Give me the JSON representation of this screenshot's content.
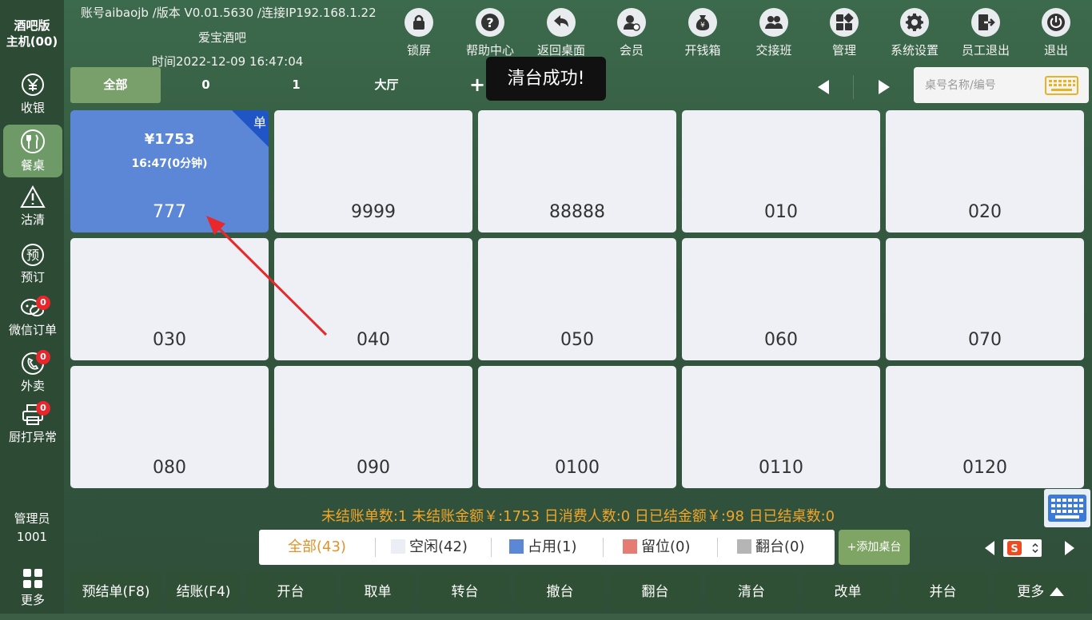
{
  "sidebar": {
    "title_line1": "酒吧版",
    "title_line2": "主机(00)",
    "items": [
      {
        "label": "收银",
        "icon": "yen-circle-icon",
        "badge": ""
      },
      {
        "label": "餐桌",
        "icon": "fork-knife-icon",
        "badge": ""
      },
      {
        "label": "沽清",
        "icon": "warning-icon",
        "badge": ""
      },
      {
        "label": "预订",
        "icon": "reserve-icon",
        "badge": ""
      },
      {
        "label": "微信订单",
        "icon": "wechat-icon",
        "badge": "0"
      },
      {
        "label": "外卖",
        "icon": "phone-icon",
        "badge": "0"
      },
      {
        "label": "厨打异常",
        "icon": "printer-icon",
        "badge": "0"
      }
    ],
    "user_role": "管理员",
    "user_id": "1001",
    "more_label": "更多"
  },
  "header": {
    "account_info": "账号aibaojb /版本 V0.01.5630 /连接IP192.168.1.22",
    "shop_name": "爱宝酒吧",
    "time_text": "时间2022-12-09 16:47:04",
    "toolbar": [
      {
        "label": "锁屏",
        "icon": "lock-icon"
      },
      {
        "label": "帮助中心",
        "icon": "help-icon"
      },
      {
        "label": "返回桌面",
        "icon": "back-arrow-icon"
      },
      {
        "label": "会员",
        "icon": "member-icon"
      },
      {
        "label": "开钱箱",
        "icon": "money-bag-icon"
      },
      {
        "label": "交接班",
        "icon": "handover-icon"
      },
      {
        "label": "管理",
        "icon": "grid-manage-icon"
      },
      {
        "label": "系统设置",
        "icon": "gear-icon"
      },
      {
        "label": "员工退出",
        "icon": "logout-icon"
      },
      {
        "label": "退出",
        "icon": "power-icon"
      }
    ]
  },
  "area_tabs": [
    "全部",
    "0",
    "1",
    "大厅"
  ],
  "add_tab_label": "+",
  "toast": "清台成功!",
  "search": {
    "placeholder": "桌号名称/编号"
  },
  "tables": [
    {
      "name": "777",
      "status": "busy",
      "amount": "¥1753",
      "time": "16:47(0分钟)",
      "corner": "单"
    },
    {
      "name": "9999",
      "status": "free"
    },
    {
      "name": "88888",
      "status": "free"
    },
    {
      "name": "010",
      "status": "free"
    },
    {
      "name": "020",
      "status": "free"
    },
    {
      "name": "030",
      "status": "free"
    },
    {
      "name": "040",
      "status": "free"
    },
    {
      "name": "050",
      "status": "free"
    },
    {
      "name": "060",
      "status": "free"
    },
    {
      "name": "070",
      "status": "free"
    },
    {
      "name": "080",
      "status": "free"
    },
    {
      "name": "090",
      "status": "free"
    },
    {
      "name": "0100",
      "status": "free"
    },
    {
      "name": "0110",
      "status": "free"
    },
    {
      "name": "0120",
      "status": "free"
    }
  ],
  "summary": "未结账单数:1  未结账金额￥:1753   日消费人数:0  日已结金额￥:98  日已结桌数:0",
  "legend": {
    "all": "全部(43)",
    "free": "空闲(42)",
    "busy": "占用(1)",
    "reserved": "留位(0)",
    "turn": "翻台(0)",
    "colors": {
      "all": "#e0932a",
      "free": "#eceef5",
      "busy": "#5b87d6",
      "reserved": "#e57c74",
      "turn": "#b5b5b5"
    }
  },
  "add_table_label": "+添加桌台",
  "bottom_buttons": [
    "预结单(F8)",
    "结账(F4)",
    "开台",
    "取单",
    "转台",
    "撤台",
    "翻台",
    "清台",
    "改单",
    "并台",
    "更多"
  ]
}
